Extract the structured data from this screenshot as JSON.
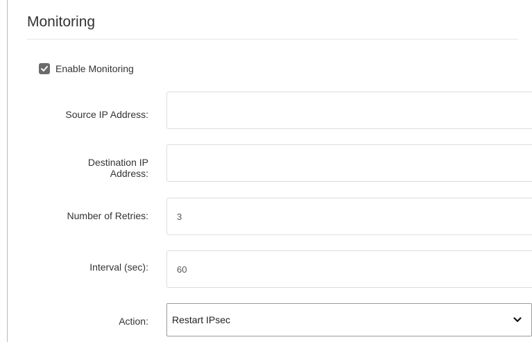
{
  "section": {
    "title": "Monitoring"
  },
  "enable_monitoring": {
    "label": "Enable Monitoring",
    "checked": true
  },
  "fields": {
    "source_ip": {
      "label": "Source IP Address:",
      "value": ""
    },
    "destination_ip": {
      "label_line1": "Destination IP",
      "label_line2": "Address:",
      "value": ""
    },
    "retries": {
      "label": "Number of Retries:",
      "value": "3"
    },
    "interval": {
      "label": "Interval (sec):",
      "value": "60"
    }
  },
  "action": {
    "label": "Action:",
    "selected": "Restart IPsec"
  },
  "colors": {
    "checkbox_fill": "#6b6b6b",
    "text": "#333333",
    "input_border": "#dcdcdc"
  },
  "icons": {
    "checkbox": "checkmark-icon",
    "select": "chevron-down-icon"
  }
}
